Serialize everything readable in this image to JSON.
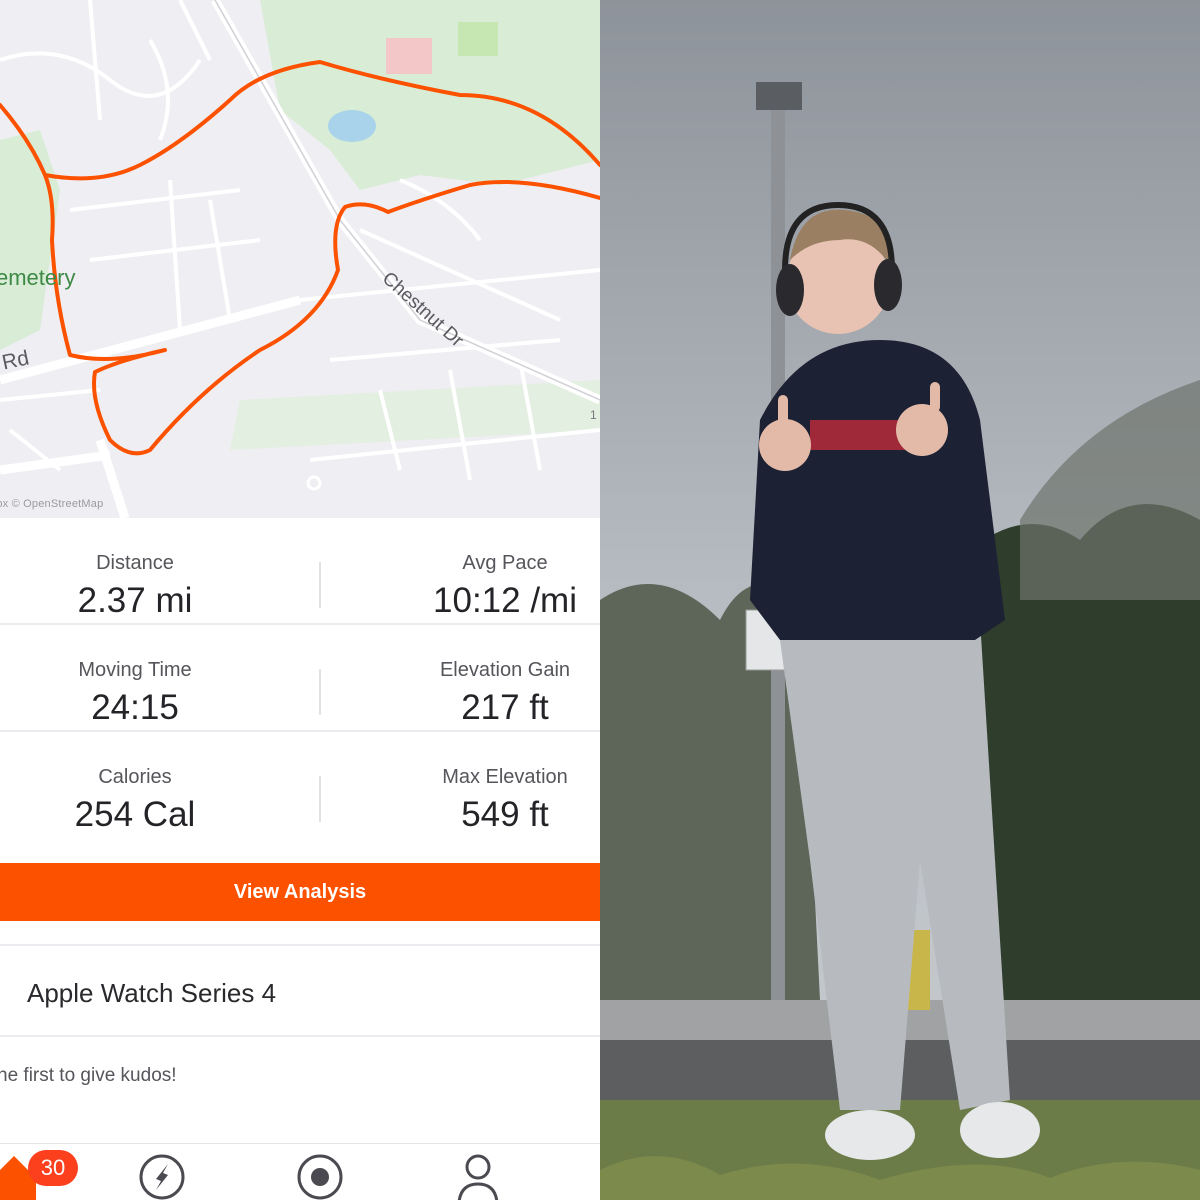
{
  "map": {
    "labels": {
      "cemetery": "emetery",
      "street": "Chestnut Dr",
      "road": "Rd",
      "attribution": "box © OpenStreetMap",
      "edge_number": "1"
    },
    "route_color": "#fc5200"
  },
  "stats": {
    "distance": {
      "label": "Distance",
      "value": "2.37 mi"
    },
    "avg_pace": {
      "label": "Avg Pace",
      "value": "10:12 /mi"
    },
    "moving_time": {
      "label": "Moving Time",
      "value": "24:15"
    },
    "elevation_gain": {
      "label": "Elevation Gain",
      "value": "217 ft"
    },
    "calories": {
      "label": "Calories",
      "value": "254 Cal"
    },
    "max_elevation": {
      "label": "Max Elevation",
      "value": "549 ft"
    }
  },
  "actions": {
    "view_analysis": "View Analysis"
  },
  "device": {
    "name": "Apple Watch Series 4"
  },
  "kudos": {
    "prompt": "he first to give kudos!"
  },
  "tabbar": {
    "items": [
      {
        "icon": "home-icon",
        "badge": "30"
      },
      {
        "icon": "compass-icon"
      },
      {
        "icon": "record-icon"
      },
      {
        "icon": "profile-icon"
      }
    ]
  },
  "colors": {
    "accent": "#fc5200",
    "badge": "#fc3f1d",
    "park": "#d9ecd6"
  },
  "photo": {
    "description_icon": "photo-person-thumbs-up"
  }
}
